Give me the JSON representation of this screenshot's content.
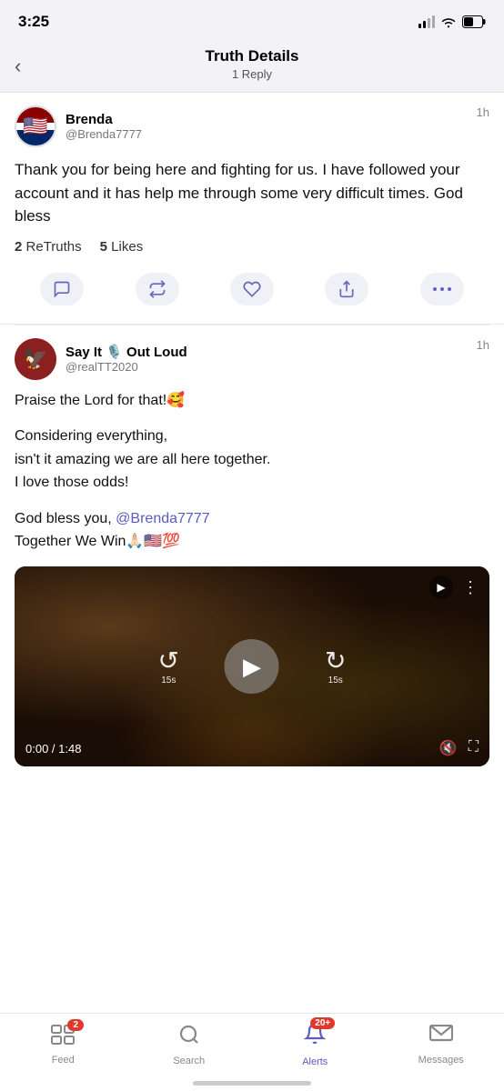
{
  "statusBar": {
    "time": "3:25",
    "signal": "2 bars",
    "wifi": true,
    "battery": "50%"
  },
  "header": {
    "backLabel": "‹",
    "title": "Truth Details",
    "subtitle": "1 Reply"
  },
  "post1": {
    "displayName": "Brenda",
    "handle": "@Brenda7777",
    "time": "1h",
    "text": "Thank you for being here and fighting for us. I have followed your account and it has help me through some very difficult times. God bless",
    "retruths": "2",
    "retruths_label": "ReTruths",
    "likes": "5",
    "likes_label": "Likes"
  },
  "post2": {
    "displayName": "Say It 🎙️ Out Loud",
    "handle": "@realTT2020",
    "time": "1h",
    "line1": "Praise the Lord for that!🥰",
    "line2": "Considering everything,\nisn't it amazing we are all here together.\nI love those odds!",
    "line3": "God bless you, @Brenda7777\nTogether We Win🙏🏻🇺🇸💯",
    "video": {
      "time_current": "0:00",
      "time_total": "1:48",
      "skip_back": "15s",
      "skip_fwd": "15s"
    }
  },
  "bottomNav": {
    "items": [
      {
        "id": "feed",
        "label": "Feed",
        "badge": "2",
        "active": false
      },
      {
        "id": "search",
        "label": "Search",
        "badge": "",
        "active": false
      },
      {
        "id": "alerts",
        "label": "Alerts",
        "badge": "20+",
        "active": true
      },
      {
        "id": "messages",
        "label": "Messages",
        "badge": "",
        "active": false
      }
    ]
  }
}
